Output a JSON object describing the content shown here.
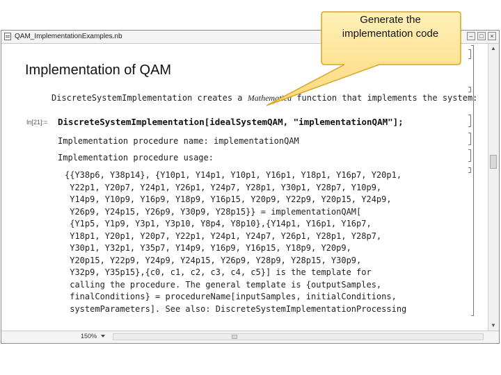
{
  "window": {
    "title": "QAM_ImplementationExamples.nb"
  },
  "notebook": {
    "heading": "Implementation of QAM",
    "description_prefix": "DiscreteSystemImplementation creates a ",
    "description_emphasis": "Mathematica",
    "description_suffix": " function that implements the system:",
    "input_label": "In[21]:=",
    "input_code": "DiscreteSystemImplementation[idealSystemQAM, \"implementationQAM\"];",
    "output_line1": "Implementation procedure name: implementationQAM",
    "output_line2": "Implementation procedure usage:",
    "usage_lines": [
      "{{Y38p6, Y38p14}, {Y10p1, Y14p1, Y10p1, Y16p1, Y18p1, Y16p7, Y20p1,",
      " Y22p1, Y20p7, Y24p1, Y26p1, Y24p7, Y28p1, Y30p1, Y28p7, Y10p9,",
      " Y14p9, Y10p9, Y16p9, Y18p9, Y16p15, Y20p9, Y22p9, Y20p15, Y24p9,",
      " Y26p9, Y24p15, Y26p9, Y30p9, Y28p15}} = implementationQAM[",
      " {Y1p5, Y1p9, Y3p1, Y3p10, Y8p4, Y8p10},{Y14p1, Y16p1, Y16p7,",
      " Y18p1, Y20p1, Y20p7, Y22p1, Y24p1, Y24p7, Y26p1, Y28p1, Y28p7,",
      " Y30p1, Y32p1, Y35p7, Y14p9, Y16p9, Y16p15, Y18p9, Y20p9,",
      " Y20p15, Y22p9, Y24p9, Y24p15, Y26p9, Y28p9, Y28p15, Y30p9,",
      " Y32p9, Y35p15},{c0, c1, c2, c3, c4, c5}] is the template for",
      " calling the procedure. The general template is {outputSamples,",
      " finalConditions} = procedureName[inputSamples, initialConditions,",
      " systemParameters]. See also: DiscreteSystemImplementationProcessing"
    ]
  },
  "statusbar": {
    "zoom": "150%"
  },
  "window_buttons": {
    "minimize": "–",
    "maximize": "□",
    "close": "×"
  },
  "scroll": {
    "up": "▲",
    "down": "▼"
  },
  "callout": {
    "text_line1": "Generate the",
    "text_line2": "implementation code",
    "fill": "#fdd87a",
    "border": "#d9a520"
  }
}
